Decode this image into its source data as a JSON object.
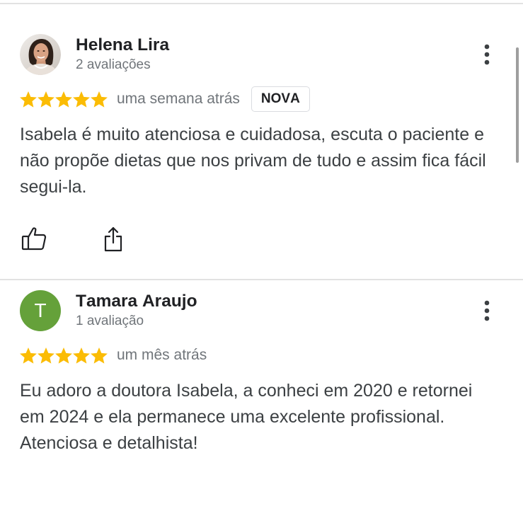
{
  "reviews": [
    {
      "author": "Helena Lira",
      "author_meta": "2 avaliações",
      "rating": 5,
      "time": "uma semana atrás",
      "badge": "NOVA",
      "text": "Isabela é muito atenciosa e cuidadosa, escuta o paciente e não propõe dietas que nos privam de tudo e assim fica fácil segui-la.",
      "icons": {
        "menu": "more-vert-icon",
        "like": "thumbs-up-icon",
        "share": "share-icon"
      }
    },
    {
      "author": "Tamara Araujo",
      "author_meta": "1 avaliação",
      "avatar": {
        "initial": "T",
        "color": "#65a13a"
      },
      "rating": 5,
      "time": "um mês atrás",
      "text": "Eu adoro a doutora Isabela, a conheci em 2020 e retornei em 2024 e ela permanece uma excelente profissional. Atenciosa e detalhista!",
      "icons": {
        "menu": "more-vert-icon"
      }
    }
  ],
  "colors": {
    "star": "#fbbc04",
    "primary_text": "#202124",
    "body_text": "#3c4043",
    "secondary_text": "#70757a",
    "divider": "#dadce0",
    "scrollbar": "#9e9e9e"
  }
}
